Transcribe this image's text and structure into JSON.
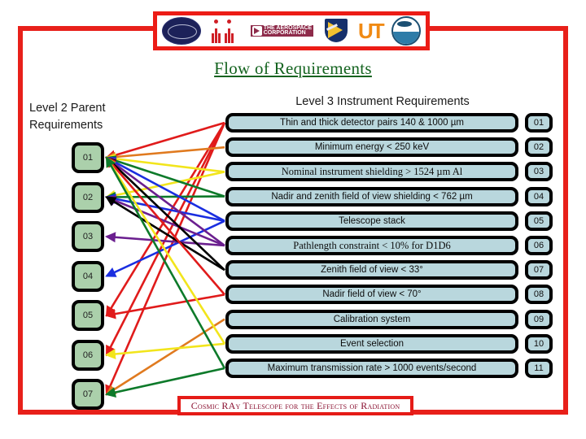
{
  "slide": {
    "title": "Flow of Requirements",
    "footer_text": "Cosmic RAy Telescope for the Effects of Radiation",
    "frame_color": "#e8201a",
    "title_color": "#14631f",
    "footer_color": "#8a1030"
  },
  "logos": [
    {
      "name": "mission-seal-logo",
      "label": ""
    },
    {
      "name": "figures-logo",
      "label": ""
    },
    {
      "name": "aerospace-corporation-logo",
      "line1": "THE AEROSPACE",
      "line2": "CORPORATION"
    },
    {
      "name": "air-force-research-lab-logo",
      "label": ""
    },
    {
      "name": "ut-logo",
      "label": "UT"
    },
    {
      "name": "noaa-logo",
      "label": ""
    }
  ],
  "left": {
    "heading_line1": "Level 2 Parent",
    "heading_line2": "Requirements",
    "box_fill": "#abd0ab",
    "items": [
      {
        "id": "01"
      },
      {
        "id": "02"
      },
      {
        "id": "03"
      },
      {
        "id": "04"
      },
      {
        "id": "05"
      },
      {
        "id": "06"
      },
      {
        "id": "07"
      }
    ]
  },
  "right": {
    "heading": "Level 3 Instrument Requirements",
    "row_fill": "#b9d7dd",
    "items": [
      {
        "id": "01",
        "text": "Thin and thick detector pairs 140 & 1000 µm",
        "font": "sans",
        "connector_color": "#e01b1b"
      },
      {
        "id": "02",
        "text": "Minimum energy < 250 keV",
        "font": "sans",
        "connector_color": "#e07a1f"
      },
      {
        "id": "03",
        "text": "Nominal instrument shielding > 1524 µm Al",
        "font": "serif",
        "connector_color": "#f2e51c"
      },
      {
        "id": "04",
        "text": "Nadir and zenith field of view shielding < 762 µm",
        "font": "sans",
        "connector_color": "#0d7a2a"
      },
      {
        "id": "05",
        "text": "Telescope stack",
        "font": "sans",
        "connector_color": "#1a2ee0"
      },
      {
        "id": "06",
        "text": "Pathlength constraint < 10% for D1D6",
        "font": "serif",
        "connector_color": "#6b1f8f"
      },
      {
        "id": "07",
        "text": "Zenith field of view < 33°",
        "font": "sans",
        "connector_color": "#000000"
      },
      {
        "id": "08",
        "text": "Nadir field of view < 70°",
        "font": "sans",
        "connector_color": "#e01b1b"
      },
      {
        "id": "09",
        "text": "Calibration system",
        "font": "sans",
        "connector_color": "#e07a1f"
      },
      {
        "id": "10",
        "text": "Event selection",
        "font": "sans",
        "connector_color": "#f2e51c"
      },
      {
        "id": "11",
        "text": "Maximum transmission rate > 1000 events/second",
        "font": "sans",
        "connector_color": "#0d7a2a"
      }
    ]
  },
  "connections": [
    {
      "from_right": "01",
      "to_left": "01",
      "color": "#e01b1b"
    },
    {
      "from_right": "01",
      "to_left": "05",
      "color": "#e01b1b"
    },
    {
      "from_right": "01",
      "to_left": "06",
      "color": "#e01b1b"
    },
    {
      "from_right": "01",
      "to_left": "07",
      "color": "#e01b1b"
    },
    {
      "from_right": "02",
      "to_left": "01",
      "color": "#e07a1f"
    },
    {
      "from_right": "03",
      "to_left": "01",
      "color": "#f2e51c"
    },
    {
      "from_right": "03",
      "to_left": "02",
      "color": "#f2e51c"
    },
    {
      "from_right": "04",
      "to_left": "01",
      "color": "#0d7a2a"
    },
    {
      "from_right": "04",
      "to_left": "02",
      "color": "#0d7a2a"
    },
    {
      "from_right": "05",
      "to_left": "01",
      "color": "#1a2ee0"
    },
    {
      "from_right": "05",
      "to_left": "02",
      "color": "#1a2ee0"
    },
    {
      "from_right": "05",
      "to_left": "04",
      "color": "#1a2ee0"
    },
    {
      "from_right": "06",
      "to_left": "01",
      "color": "#6b1f8f"
    },
    {
      "from_right": "06",
      "to_left": "02",
      "color": "#6b1f8f"
    },
    {
      "from_right": "06",
      "to_left": "03",
      "color": "#6b1f8f"
    },
    {
      "from_right": "07",
      "to_left": "01",
      "color": "#000000"
    },
    {
      "from_right": "07",
      "to_left": "02",
      "color": "#000000"
    },
    {
      "from_right": "08",
      "to_left": "01",
      "color": "#e01b1b"
    },
    {
      "from_right": "08",
      "to_left": "05",
      "color": "#e01b1b"
    },
    {
      "from_right": "09",
      "to_left": "07",
      "color": "#e07a1f"
    },
    {
      "from_right": "10",
      "to_left": "01",
      "color": "#f2e51c"
    },
    {
      "from_right": "10",
      "to_left": "06",
      "color": "#f2e51c"
    },
    {
      "from_right": "11",
      "to_left": "01",
      "color": "#0d7a2a"
    },
    {
      "from_right": "11",
      "to_left": "07",
      "color": "#0d7a2a"
    }
  ]
}
